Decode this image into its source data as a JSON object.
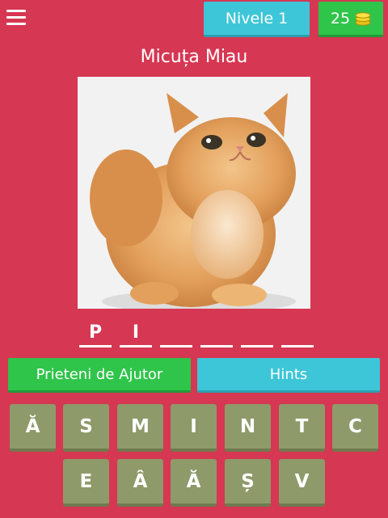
{
  "header": {
    "levels_label": "Nivele 1",
    "coins": "25"
  },
  "title": "Micuța Miau",
  "answer_slots": [
    "P",
    "I",
    "",
    "",
    "",
    ""
  ],
  "buttons": {
    "help": "Prieteni de Ajutor",
    "hints": "Hints"
  },
  "keyboard": {
    "row1": [
      "Ă",
      "S",
      "M",
      "I",
      "N",
      "T",
      "C"
    ],
    "row2": [
      "E",
      "Â",
      "Ă",
      "Ș",
      "V"
    ]
  },
  "colors": {
    "background": "#d63752",
    "blue_button": "#3dc6d8",
    "green_button": "#2fc44a",
    "key": "#8e9a6a"
  },
  "icons": {
    "menu": "hamburger-menu-icon",
    "coins": "coin-stack-icon"
  }
}
